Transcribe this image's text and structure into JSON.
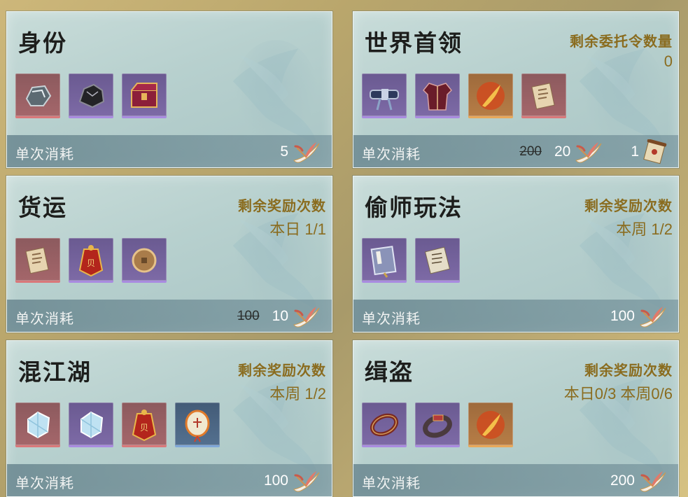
{
  "footer_label": "单次消耗",
  "cards": [
    {
      "title": "身份",
      "cost": "5"
    },
    {
      "title": "世界首领",
      "remain_label": "剩余委托令数量",
      "remain_value": "0",
      "old_cost": "200",
      "cost": "20",
      "token_count": "1"
    },
    {
      "title": "货运",
      "remain_label": "剩余奖励次数",
      "remain_value": "本日 1/1",
      "old_cost": "100",
      "cost": "10"
    },
    {
      "title": "偷师玩法",
      "remain_label": "剩余奖励次数",
      "remain_value": "本周 1/2",
      "cost": "100"
    },
    {
      "title": "混江湖",
      "remain_label": "剩余奖励次数",
      "remain_value": "本周 1/2",
      "cost": "100"
    },
    {
      "title": "缉盗",
      "remain_label": "剩余奖励次数",
      "remain_value": "本日0/3 本周0/6",
      "cost": "200"
    }
  ],
  "colors": {
    "accent_gold": "#8a6c1f",
    "title": "#1d1e1c",
    "panel": "#b7d0ce"
  }
}
